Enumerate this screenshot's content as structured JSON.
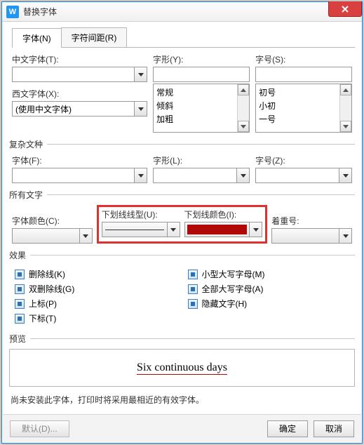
{
  "window": {
    "title": "替换字体"
  },
  "tabs": {
    "font": "字体(N)",
    "spacing": "字符间距(R)"
  },
  "labels": {
    "cjk_font": "中文字体(T):",
    "latin_font": "西文字体(X):",
    "style": "字形(Y):",
    "size": "字号(S):",
    "complex_group": "复杂文种",
    "complex_font": "字体(F):",
    "complex_style": "字形(L):",
    "complex_size": "字号(Z):",
    "all_text_group": "所有文字",
    "font_color": "字体颜色(C):",
    "underline_style": "下划线线型(U):",
    "underline_color": "下划线颜色(I):",
    "emphasis": "着重号:",
    "effects_group": "效果",
    "preview_group": "预览"
  },
  "values": {
    "latin_font": "(使用中文字体)",
    "underline_color": "#b10808",
    "preview_text": "Six continuous days"
  },
  "style_list": [
    "常规",
    "倾斜",
    "加粗"
  ],
  "size_list": [
    "初号",
    "小初",
    "一号"
  ],
  "effects": {
    "strike": "删除线(K)",
    "dstrike": "双删除线(G)",
    "super": "上标(P)",
    "sub": "下标(T)",
    "smallcaps": "小型大写字母(M)",
    "allcaps": "全部大写字母(A)",
    "hidden": "隐藏文字(H)"
  },
  "note": "尚未安装此字体，打印时将采用最相近的有效字体。",
  "buttons": {
    "default": "默认(D)...",
    "ok": "确定",
    "cancel": "取消"
  }
}
